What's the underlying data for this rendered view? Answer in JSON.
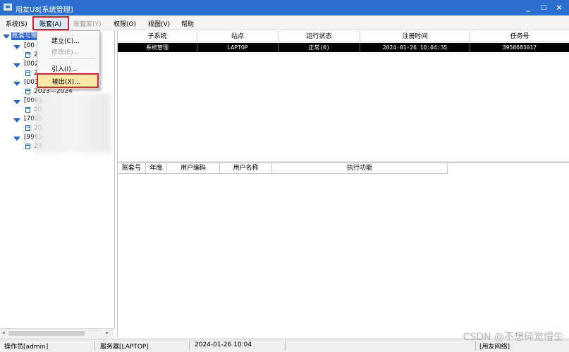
{
  "window": {
    "title": "用友U8[系统管理]",
    "min": "_",
    "max": "□",
    "close": "×"
  },
  "menubar": [
    {
      "label": "系统(S)",
      "enabled": true
    },
    {
      "label": "账套(A)",
      "enabled": true
    },
    {
      "label": "账套库(Y)",
      "enabled": false
    },
    {
      "label": "权限(O)",
      "enabled": true
    },
    {
      "label": "视图(V)",
      "enabled": true
    },
    {
      "label": "帮助",
      "enabled": true
    }
  ],
  "dropdown": {
    "items": [
      {
        "label": "建立(C)...",
        "enabled": true
      },
      {
        "label": "修改(E)...",
        "enabled": false
      },
      {
        "label": "引入(I)...",
        "enabled": true
      },
      {
        "label": "输出(X)...",
        "enabled": true
      }
    ]
  },
  "tree": {
    "root": "账套与账套库",
    "nodes": [
      {
        "label": "[00",
        "child": "2"
      },
      {
        "label": "[002",
        "child": "2"
      },
      {
        "label": "[003",
        "child": "2023—2024"
      },
      {
        "label": "[006]-",
        "child": "20"
      },
      {
        "label": "[702]-",
        "child": "20"
      },
      {
        "label": "[999]-",
        "child": "20"
      }
    ]
  },
  "grid_top": {
    "columns": [
      "子系统",
      "站点",
      "运行状态",
      "注册时间",
      "任务号"
    ],
    "rows": [
      [
        "系统管理",
        "LAPTOP",
        "正常(0)",
        "2024-01-26 10:04:35",
        "3958683017"
      ]
    ]
  },
  "grid_bottom": {
    "columns": [
      "账套号",
      "年度",
      "用户编码",
      "用户名称",
      "执行功能"
    ]
  },
  "statusbar": {
    "operator": "操作员[admin]",
    "server": "服务器[LAPTOP]",
    "date": "2024-01-26 10:04",
    "network": "[用友网络]"
  },
  "watermark": "CSDN @不想碎觉懵生",
  "colors": {
    "titlebar": "#2d6fd1",
    "highlight_border": "#e0202c",
    "selected_row": "#000000"
  }
}
